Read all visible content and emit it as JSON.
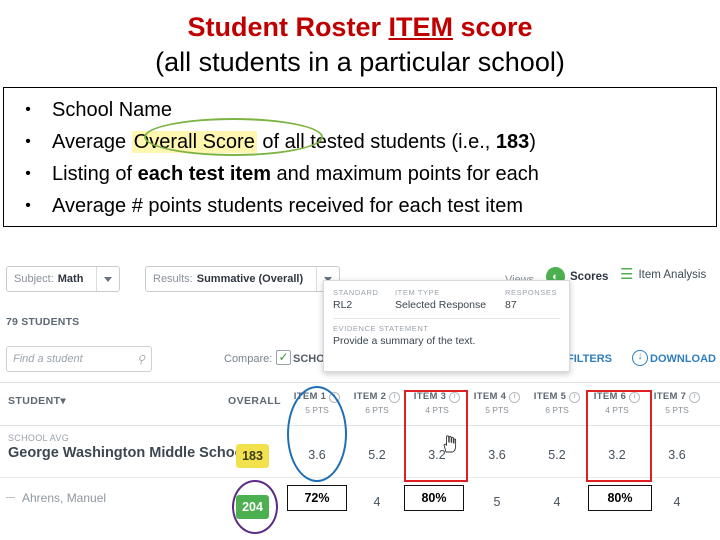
{
  "slide": {
    "title_line1_part1": "Student Roster ",
    "title_line1_underline": "ITEM",
    "title_line1_part2": " score",
    "title_line2": "(all students in a particular school)",
    "bullets": [
      {
        "pre": "School Name",
        "hl": "",
        "post": ""
      },
      {
        "pre": "Average ",
        "hl": "Overall Score",
        "post": " of all tested students (i.e., 183)"
      },
      {
        "pre": "Listing of ",
        "hl": "",
        "post": "each test item and maximum points for each"
      },
      {
        "pre": "Average # points students received for each test item",
        "hl": "",
        "post": ""
      }
    ],
    "bullet_marker": "•"
  },
  "app": {
    "toolbar": {
      "subject_label": "Subject:",
      "subject_value": "Math",
      "results_label": "Results:",
      "results_value": "Summative (Overall)",
      "views_label": "Views",
      "scores_tab": "Scores",
      "item_analysis_tab": "Item Analysis",
      "scores_icon": "bar-chart-icon",
      "item_analysis_icon": "list-icon"
    },
    "students_count": "79 STUDENTS",
    "search_placeholder": "Find a student",
    "search_icon": "search-icon",
    "compare_label": "Compare:",
    "compare_checked": "✓",
    "compare_scope": "SCHOOL",
    "filters_label": "FILTERS",
    "download_label": "DOWNLOAD",
    "popup": {
      "standard_header": "STANDARD",
      "standard_value": "RL2",
      "item_type_header": "ITEM TYPE",
      "item_type_value": "Selected Response",
      "responses_header": "RESPONSES",
      "responses_value": "87",
      "evidence_header": "EVIDENCE STATEMENT",
      "evidence_value": "Provide a summary of the text."
    },
    "table": {
      "col_student": "STUDENT",
      "col_student_caret": "▾",
      "col_overall": "OVERALL",
      "items": [
        {
          "name": "ITEM 1",
          "pts": "5 PTS"
        },
        {
          "name": "ITEM 2",
          "pts": "6 PTS"
        },
        {
          "name": "ITEM 3",
          "pts": "4 PTS"
        },
        {
          "name": "ITEM 4",
          "pts": "5 PTS"
        },
        {
          "name": "ITEM 5",
          "pts": "6 PTS"
        },
        {
          "name": "ITEM 6",
          "pts": "4 PTS"
        },
        {
          "name": "ITEM 7",
          "pts": "5 PTS"
        }
      ],
      "school_avg_label": "SCHOOL AVG",
      "school_avg_name": "George Washington Middle School",
      "school_avg_overall": "183",
      "school_avg_items": [
        "3.6",
        "5.2",
        "3.2",
        "3.6",
        "5.2",
        "3.2",
        "3.6"
      ],
      "student_row_name": "Ahrens, Manuel",
      "student_overall": "204"
    },
    "annotations": {
      "box_item3_pct": "72%",
      "box_item4_pct": "80%",
      "box_item6_pct": "80%"
    }
  }
}
